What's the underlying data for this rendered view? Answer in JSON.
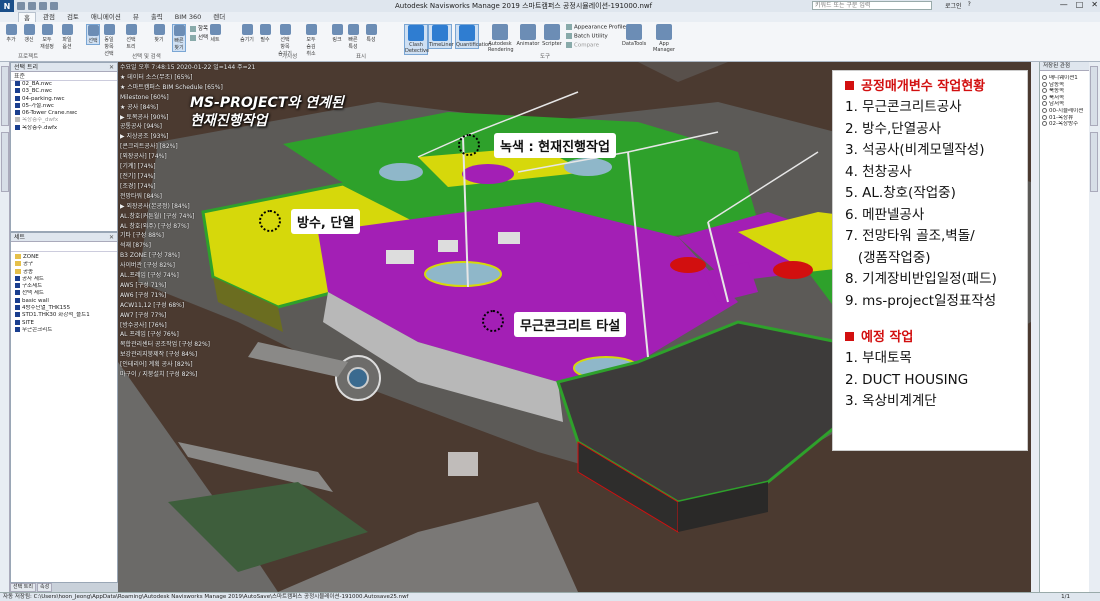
{
  "titlebar": {
    "app_letter": "N",
    "title": "Autodesk Navisworks Manage 2019    스마트캠퍼스 공정시뮬레이션-191000.nwf",
    "search_placeholder": "키워드 또는 구문 입력",
    "user_label": "로그인",
    "help": "?",
    "win_min": "—",
    "win_max": "□",
    "win_close": "✕"
  },
  "tabs": [
    "홈",
    "관점",
    "검토",
    "애니메이션",
    "뷰",
    "출력",
    "BIM 360",
    "렌더"
  ],
  "ribbon": {
    "groups": [
      "프로젝트",
      "선택 및 검색",
      "가시성",
      "표시",
      "도구"
    ],
    "buttons": [
      "추가",
      "갱신",
      "모두 재설정",
      "파일 옵션",
      "선택",
      "동일 항목 선택",
      "선택 트리",
      "찾기",
      "빠른 찾기",
      "세트",
      "숨기기",
      "필수",
      "선택 항목 숨기기",
      "모두 숨김 취소",
      "링크",
      "빠른 특성",
      "특성",
      "Clash Detective",
      "TimeLiner",
      "Quantification",
      "Autodesk Rendering",
      "Animator",
      "Scripter",
      "DataTools",
      "App Manager"
    ],
    "small": [
      "항목 찾기",
      "선택",
      "Appearance Profiler",
      "Batch Utility",
      "Compare"
    ]
  },
  "left_top_panel": {
    "title": "선택 트리",
    "filter": "표준",
    "items": [
      "02_BA.nwc",
      "03_BC.nwc",
      "04-parking.nwc",
      "05-가설.nwc",
      "06-Tower Crane.nwc",
      "옥상층주_dwfx",
      "옥상층주.dwfx"
    ]
  },
  "left_bottom_panel": {
    "title": "세트",
    "items": [
      "ZONE",
      "공구",
      "공종",
      "공사 세트",
      "구조세트",
      "선택 세트",
      "basic wall",
      "4방수단열_THK155",
      "STD1.THK30 화강석_플트1",
      "SITE",
      "무근콘크리트"
    ]
  },
  "overlay_lines": [
    "수요일 오후 7:48:15 2020-01-22 일=144 주=21",
    "★ 데이터 소스(무조) [65%]",
    "★ 스마트캠퍼스 BIM Schedule [65%]",
    "Milestone [60%]",
    "★ 공사 [84%]",
    "▶ 토목공사 [90%]",
    "공통공사 [94%]",
    "▶ 지상공조 [93%]",
    "  [콘크리트공사] [82%]",
    "  [외장공사] [74%]",
    "  [기계] [74%]",
    "  [전기] [74%]",
    "  [조경] [74%]",
    "전망타워 [84%]",
    "▶ 외장공사(본공정) [84%]",
    "AL.창호(커튼월) [구성 74%]",
    "AL 창호(외주) [구성 87%]",
    "기타 [구성 88%]",
    "석재 [87%]",
    "B3 ZONE [구성 78%]",
    "사이버관 [구성 82%]",
    "AL.프레임 [구성 74%]",
    "AW5 [구성 71%]",
    "AW6 [구성 71%]",
    "ACW11,12 [구성 68%]",
    "AW7 [구성 77%]",
    "[방수공사] [76%]",
    "AL 프레임 [구성 76%]",
    "복합관리센터 공조작업 [구성 82%]",
    "보강관리지붕제작 [구성 84%]",
    "[인테리어] 계획 공사 [82%]",
    "마구이 / 지붕설치 [구성 82%]"
  ],
  "annotations": {
    "headline": "MS-PROJECT와 연계된",
    "headline2": "현재진행작업",
    "green_label": "녹색 : 현재진행작업",
    "waterproof_label": "방수, 단열",
    "concrete_label": "무근콘크리트 타설"
  },
  "info": {
    "section1": "공정매개변수 작업현황",
    "items1": [
      "1. 무근콘크리트공사",
      "2. 방수,단열공사",
      "3. 석공사(비계모델작성)",
      "4. 천창공사",
      "5. AL.창호(작업중)",
      "6. 메판넬공사",
      "7. 전망타워 골조,벽돌/",
      "   (갱폼작업중)",
      "8. 기계장비반입일정(패드)",
      "9. ms-project일정표작성"
    ],
    "section2": "예정 작업",
    "items2": [
      "1. 부대토목",
      "2. DUCT HOUSING",
      "3. 옥상비계계단"
    ]
  },
  "right_panel": {
    "title": "저장된 관점",
    "items": [
      "매니웨이션1",
      "남동쪽",
      "북동쪽",
      "북서쪽",
      "남서쪽",
      "00-시뮬레이션",
      "01-옥상뷰",
      "02-옥상방수"
    ]
  },
  "status": {
    "path": "자동 저장됨: C:\\Users\\hoon_Jeong\\AppData\\Roaming\\Autodesk Navisworks Manage 2019\\AutoSave\\스마트캠퍼스 공정시뮬레이션-191000.Autosave25.nwf",
    "pages": "1/1"
  },
  "bottom_tabs": [
    "선택 트리",
    "속성"
  ],
  "colors": {
    "green": "#2ea12b",
    "yellow": "#d6d80b",
    "purple": "#a31fb5",
    "red": "#d20f0f",
    "ground": "#4b3a30"
  }
}
